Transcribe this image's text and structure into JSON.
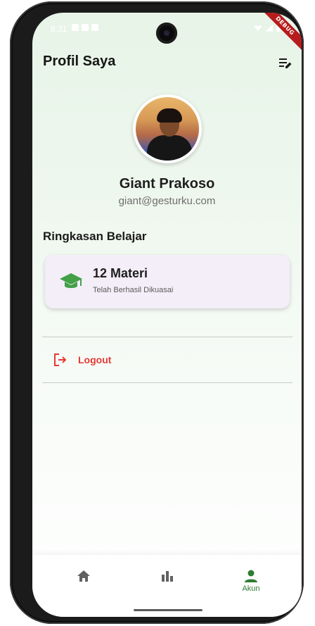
{
  "statusbar": {
    "time": "8:31",
    "debug_label": "DEBUG"
  },
  "appbar": {
    "title": "Profil Saya",
    "edit_icon": "edit-note-icon"
  },
  "profile": {
    "name": "Giant Prakoso",
    "email": "giant@gesturku.com"
  },
  "summary": {
    "section_title": "Ringkasan Belajar",
    "card_title": "12 Materi",
    "card_subtitle": "Telah Berhasil Dikuasai",
    "card_icon": "graduation-cap-icon"
  },
  "logout": {
    "label": "Logout",
    "icon": "logout-icon"
  },
  "bottom_nav": {
    "items": [
      {
        "icon": "home-icon",
        "label": ""
      },
      {
        "icon": "bar-chart-icon",
        "label": ""
      },
      {
        "icon": "person-icon",
        "label": "Akun"
      }
    ],
    "active_color": "#2E7D32",
    "inactive_color": "#616161"
  },
  "colors": {
    "accent_green": "#2E7D32",
    "logout_red": "#E53935",
    "card_bg": "#F3EEF8"
  }
}
